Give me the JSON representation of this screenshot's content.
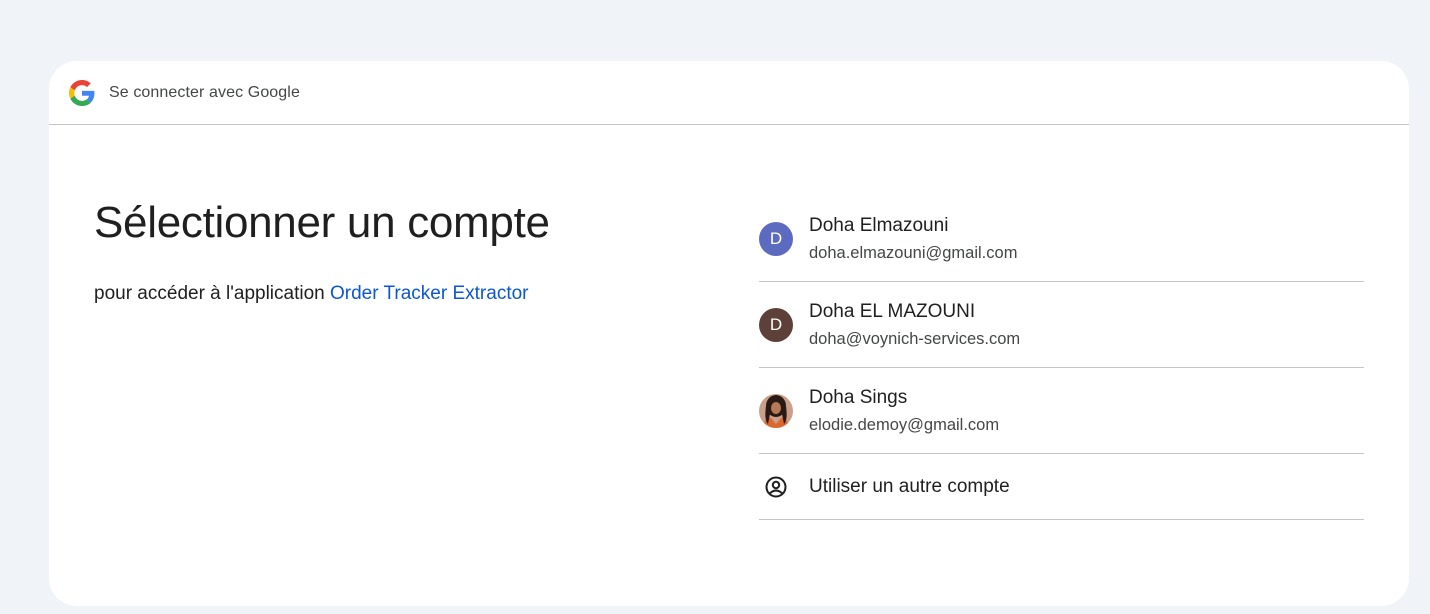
{
  "header": {
    "title": "Se connecter avec Google",
    "logo_icon": "google-g-logo"
  },
  "main": {
    "title": "Sélectionner un compte",
    "subtitle_prefix": "pour accéder à l'application ",
    "app_name": "Order Tracker Extractor"
  },
  "accounts": [
    {
      "name": "Doha Elmazouni",
      "email": "doha.elmazouni@gmail.com",
      "avatar_letter": "D",
      "avatar_color": "#5c6bc0"
    },
    {
      "name": "Doha EL MAZOUNI",
      "email": "doha@voynich-services.com",
      "avatar_letter": "D",
      "avatar_color": "#5d4037"
    },
    {
      "name": "Doha Sings",
      "email": "elodie.demoy@gmail.com",
      "avatar_letter": "",
      "avatar_type": "photo"
    }
  ],
  "other_account": {
    "label": "Utiliser un autre compte",
    "icon": "account-circle-icon"
  },
  "colors": {
    "link": "#0b57d0",
    "page_background": "#f0f4f9",
    "divider": "#c4c7c5"
  }
}
